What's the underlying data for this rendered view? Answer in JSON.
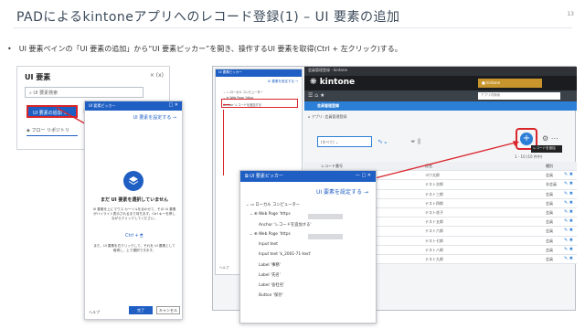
{
  "slide": {
    "title": "PADによるkintoneアプリへのレコード登録(1) – UI 要素の追加",
    "page_number": "13",
    "bullet": "UI 要素ペインの「UI 要素の追加」から“UI 要素ピッカー”を開き、操作するUI 要素を取得(Ctrl + 左クリック)する。"
  },
  "left_pane": {
    "title": "UI 要素",
    "search_placeholder": "UI 要素検索",
    "add_button": "UI 要素の追加",
    "flow_repo": "フロー リポジトリ",
    "header_icons": "×  (x)"
  },
  "picker_small": {
    "title": "UI 要素ピッカー",
    "select_target": "UI 要素を設定する",
    "empty_title": "まだ UI 要素を選択していません",
    "empty_body": "UI 要素を上にマウス カーソルを合わせて、その UI 要素がハイライト表示されるまで待ちます。Ctrl キーを押しながらクリックしてください。",
    "shortcut": "Ctrl + 🖱",
    "foot_body": "また、UI 要素を右クリックして、それを UI 要素として取得し、上で選択できます。",
    "help": "ヘルプ",
    "ok": "完了",
    "cancel": "キャンセル"
  },
  "picker_big": {
    "title": "UI 要素ピッカー",
    "select_target": "UI 要素を設定する",
    "tree": [
      "ローカル コンピューター",
      "Web Page 'https",
      "Anchor 'レコードを追加する'",
      "Web Page 'https",
      "Input text",
      "Input text 'k_2001-71-text'",
      "Label '事務'",
      "Label '氏名'",
      "Label '会社名'",
      "Button '保存'"
    ]
  },
  "kintone": {
    "window_title": "会員管理登録 - kintone",
    "logo": "kintone",
    "user": "kintone",
    "search_placeholder": "アプリ内検索",
    "app_title": "会員管理登録",
    "breadcrumb": "アプリ: 会員管理登録",
    "view_select": "(すべて)",
    "add_tooltip": "レコードを追加",
    "count": "1 - 10 (10 件中)",
    "columns": [
      "レコード番号",
      "氏名",
      "種別"
    ],
    "rows": [
      [
        "",
        "ヨウ太郎",
        "会員"
      ],
      [
        "",
        "テスト次郎",
        "非会員"
      ],
      [
        "",
        "テスト三郎",
        "会員"
      ],
      [
        "",
        "テスト四郎",
        "会員"
      ],
      [
        "",
        "テスト花子",
        "会員"
      ],
      [
        "",
        "テスト五郎",
        "会員"
      ],
      [
        "",
        "テスト六郎",
        "会員"
      ],
      [
        "",
        "テスト七郎",
        "会員"
      ],
      [
        "",
        "テスト八郎",
        "会員"
      ],
      [
        "",
        "テスト九郎",
        "会員"
      ]
    ]
  },
  "colors": {
    "accent": "#1f5fc4",
    "kintone_blue": "#2c7fd6",
    "highlight": "#d9252b"
  },
  "mini_picker": {
    "title": "UI 要素ピッカー",
    "select_target": "UI 要素を設定する",
    "local": "ローカル コンピューター",
    "web": "Web Page 'https",
    "anchor": "Anchor 'レコードを追加する'",
    "help": "ヘルプ"
  }
}
